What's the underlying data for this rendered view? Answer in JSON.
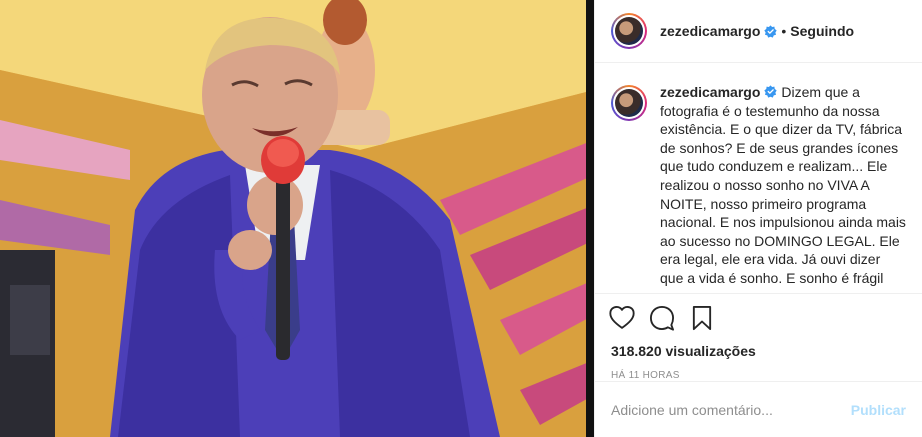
{
  "post": {
    "username": "zezedicamargo",
    "separator": "•",
    "follow_status": "Seguindo",
    "caption": "Dizem que a fotografia é o testemunho da nossa existência. E o que dizer da TV, fábrica de sonhos? E de seus grandes ícones que tudo conduzem e realizam... Ele realizou o nosso sonho no VIVA A NOITE, nosso primeiro programa nacional. E nos impulsionou ainda mais ao sucesso no DOMINGO LEGAL. Ele era legal, ele era vida. Já ouvi dizer que a vida é sonho. E sonho é frágil",
    "views": "318.820 visualizações",
    "time_ago": "HÁ 11 HORAS"
  },
  "comment": {
    "placeholder": "Adicione um comentário...",
    "publish_label": "Publicar"
  },
  "icons": {
    "verified": "verified-badge-icon",
    "like": "heart-icon",
    "comment": "comment-bubble-icon",
    "save": "bookmark-icon"
  },
  "colors": {
    "verified_blue": "#3897f0",
    "publish_disabled": "#b2dffc",
    "muted_text": "#8e8e8e",
    "border": "#efefef"
  }
}
